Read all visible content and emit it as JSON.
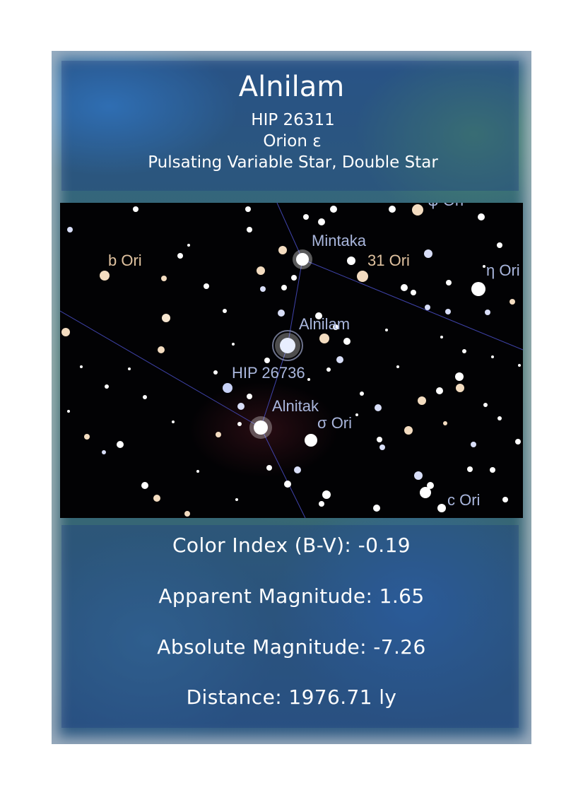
{
  "header": {
    "name": "Alnilam",
    "catalog": "HIP 26311",
    "constellation": "Orion ε",
    "type": "Pulsating Variable Star, Double Star"
  },
  "sky_labels": {
    "mintaka": "Mintaka",
    "b_ori": "b Ori",
    "ori_31": "31 Ori",
    "eta_ori": "η Ori",
    "alnilam": "Alnilam",
    "hip_26736": "HIP 26736",
    "alnitak": "Alnitak",
    "sigma_ori": "σ Ori",
    "c_ori": "c Ori",
    "top_partial": "ψ Ori"
  },
  "details": {
    "color_index": "Color Index (B-V): -0.19",
    "apparent_magnitude": "Apparent Magnitude: 1.65",
    "absolute_magnitude": "Absolute Magnitude: -7.26",
    "distance": "Distance: 1976.71 ly"
  },
  "colors": {
    "label_blue": "#a9b6dc",
    "label_orange": "#e0c2a0",
    "constellation_line": "#4a4fc8"
  }
}
